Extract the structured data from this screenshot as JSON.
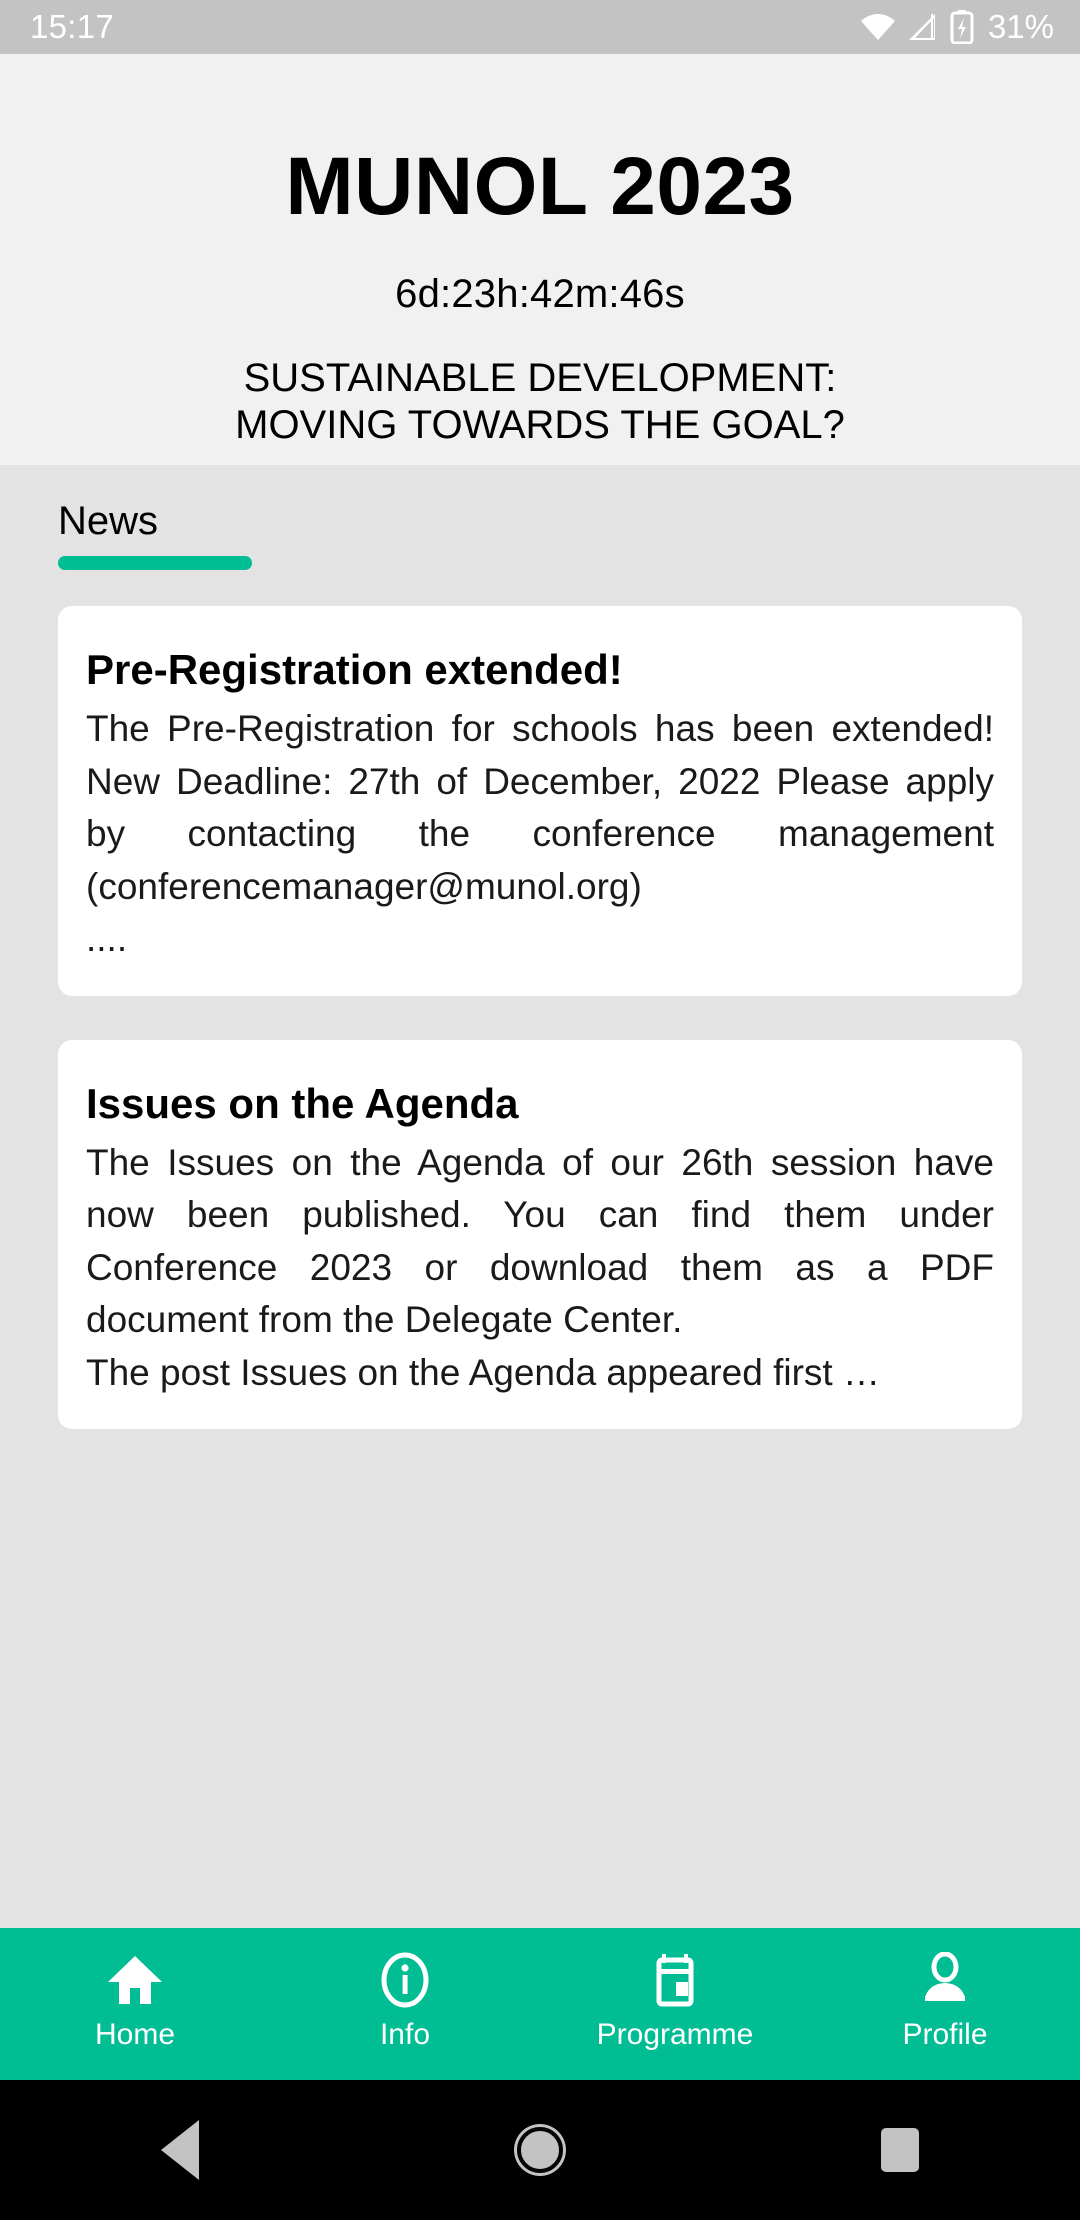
{
  "status_bar": {
    "time": "15:17",
    "battery_percent": "31%",
    "icons": [
      "wifi-icon",
      "cellular-signal-icon",
      "battery-charging-icon"
    ]
  },
  "header": {
    "title": "MUNOL 2023",
    "countdown": "6d:23h:42m:46s",
    "theme_line1": "SUSTAINABLE DEVELOPMENT:",
    "theme_line2": "MOVING TOWARDS THE GOAL?"
  },
  "tabs": {
    "active": "News",
    "items": [
      {
        "label": "News"
      }
    ]
  },
  "news": {
    "cards": [
      {
        "title": "Pre-Registration extended!",
        "body": "The Pre-Registration for schools has been extended! New Deadline: 27th of December, 2022 Please apply by contacting the conference management (conferencemanager@munol.org)",
        "tail": "...."
      },
      {
        "title": "Issues on the Agenda",
        "body": "The Issues on the Agenda of our 26th session have now been published. You can find them under Conference 2023 or download them as a PDF document from the Delegate Center.",
        "tail": "The post Issues on the Agenda appeared first …"
      }
    ]
  },
  "bottom_nav": {
    "items": [
      {
        "label": "Home",
        "icon": "home-icon"
      },
      {
        "label": "Info",
        "icon": "info-circle-icon"
      },
      {
        "label": "Programme",
        "icon": "calendar-icon"
      },
      {
        "label": "Profile",
        "icon": "person-icon"
      }
    ]
  },
  "system_nav": {
    "back": "back-icon",
    "home": "home-circle-icon",
    "recents": "recents-icon"
  },
  "colors": {
    "accent": "#00bd94",
    "hero_bg": "#f1f1f1",
    "content_bg": "#e3e3e3",
    "card_bg": "#ffffff",
    "status_bar_bg": "#c3c3c3"
  }
}
